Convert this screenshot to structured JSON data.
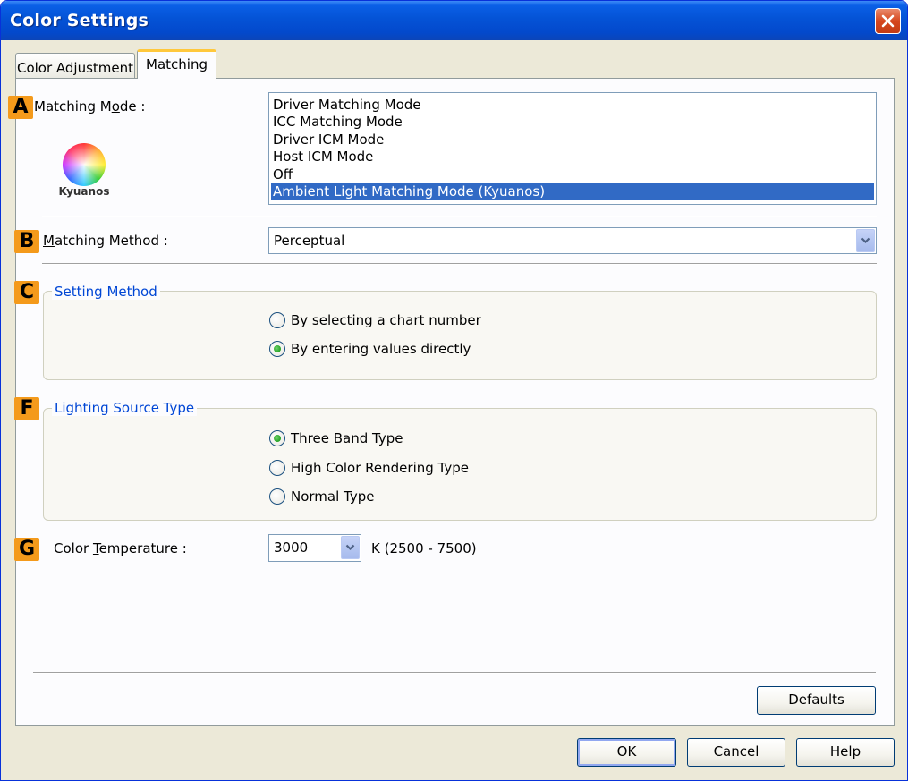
{
  "window": {
    "title": "Color Settings"
  },
  "tabs": [
    {
      "label": "Color Adjustment",
      "active": false
    },
    {
      "label": "Matching",
      "active": true
    }
  ],
  "matching_mode": {
    "badge": "A",
    "label_pre": "Matching M",
    "label_mnemonic": "o",
    "label_post": "de :",
    "options": [
      "Driver Matching Mode",
      "ICC Matching Mode",
      "Driver ICM Mode",
      "Host ICM Mode",
      "Off",
      "Ambient Light Matching Mode (Kyuanos)"
    ],
    "selected_index": 5,
    "logo_text": "Kyuanos"
  },
  "matching_method": {
    "badge": "B",
    "label_mnemonic": "M",
    "label_post": "atching Method :",
    "value": "Perceptual"
  },
  "setting_method": {
    "badge": "C",
    "title": "Setting Method",
    "options": [
      {
        "label": "By selecting a chart number",
        "checked": false
      },
      {
        "label": "By entering values directly",
        "checked": true
      }
    ]
  },
  "lighting_source": {
    "badge": "F",
    "title": "Lighting Source Type",
    "options": [
      {
        "label": "Three Band Type",
        "checked": true
      },
      {
        "label": "High Color Rendering Type",
        "checked": false
      },
      {
        "label": "Normal Type",
        "checked": false
      }
    ]
  },
  "color_temperature": {
    "badge": "G",
    "label_pre": "Color ",
    "label_mnemonic": "T",
    "label_post": "emperature :",
    "value": "3000",
    "range": "K (2500 - 7500)"
  },
  "buttons": {
    "defaults": "Defaults",
    "ok": "OK",
    "cancel": "Cancel",
    "help": "Help"
  },
  "colors": {
    "accent_badge": "#f49a1b",
    "selection": "#316ac5",
    "group_title": "#0046d5"
  }
}
